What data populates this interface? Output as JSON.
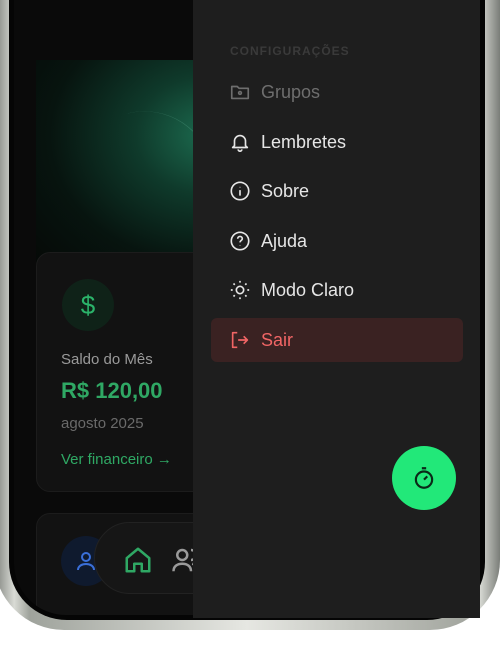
{
  "dashboard": {
    "finance_card": {
      "currency_symbol": "$",
      "label": "Saldo do Mês",
      "value": "R$ 120,00",
      "month": "agosto 2025",
      "link": "Ver financeiro →"
    }
  },
  "drawer": {
    "section_title": "CONFIGURAÇÕES",
    "items": [
      {
        "label": "Grupos",
        "icon": "folder-icon",
        "state": "disabled"
      },
      {
        "label": "Lembretes",
        "icon": "bell-icon"
      },
      {
        "label": "Sobre",
        "icon": "info-icon"
      },
      {
        "label": "Ajuda",
        "icon": "help-circle-icon"
      },
      {
        "label": "Modo Claro",
        "icon": "sun-icon"
      },
      {
        "label": "Sair",
        "icon": "logout-icon",
        "state": "danger"
      }
    ]
  },
  "fab": {
    "icon": "timer-icon"
  },
  "colors": {
    "accent": "#22e879",
    "money_green": "#2fa864",
    "danger": "#f06565",
    "drawer_bg": "#1e1e1e"
  }
}
